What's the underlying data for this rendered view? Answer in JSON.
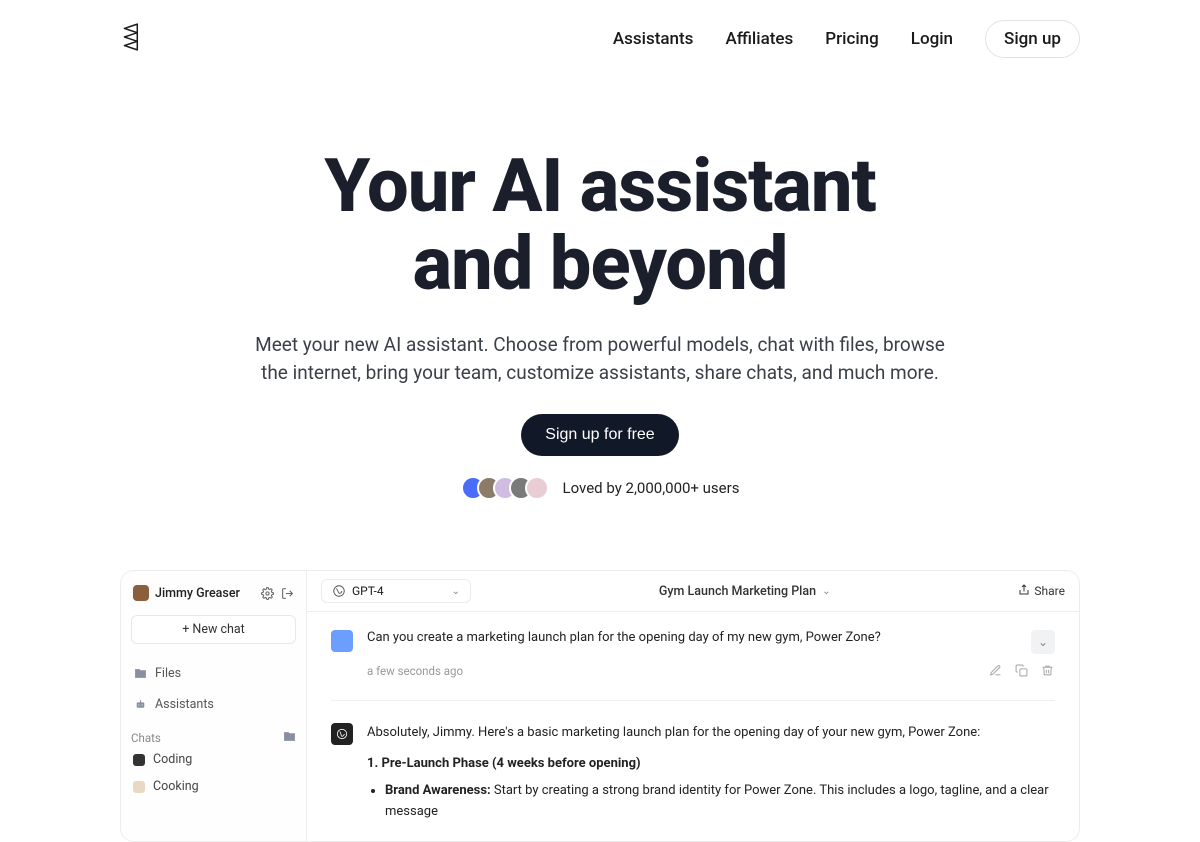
{
  "nav": {
    "links": [
      "Assistants",
      "Affiliates",
      "Pricing",
      "Login"
    ],
    "signup": "Sign up"
  },
  "hero": {
    "title_line1": "Your AI assistant",
    "title_line2": "and beyond",
    "subtitle": "Meet your new AI assistant. Choose from powerful models, chat with files, browse the internet, bring your team, customize assistants, share chats, and much more.",
    "cta": "Sign up for free",
    "social": "Loved by 2,000,000+ users"
  },
  "preview": {
    "sidebar": {
      "user": "Jimmy Greaser",
      "newchat": "+  New chat",
      "files": "Files",
      "assistants": "Assistants",
      "chats_label": "Chats",
      "chats": [
        "Coding",
        "Cooking"
      ]
    },
    "topbar": {
      "model": "GPT-4",
      "title": "Gym Launch Marketing Plan",
      "share": "Share"
    },
    "user_msg": "Can you create a marketing launch plan for the opening day of my new gym, Power Zone?",
    "timestamp": "a few seconds ago",
    "ai": {
      "intro": "Absolutely, Jimmy. Here's a basic marketing launch plan for the opening day of your new gym, Power Zone:",
      "phase": "1. Pre-Launch Phase (4 weeks before opening)",
      "bullet_lead": "Brand Awareness:",
      "bullet_rest": " Start by creating a strong brand identity for Power Zone. This includes a logo, tagline, and a clear message"
    }
  }
}
